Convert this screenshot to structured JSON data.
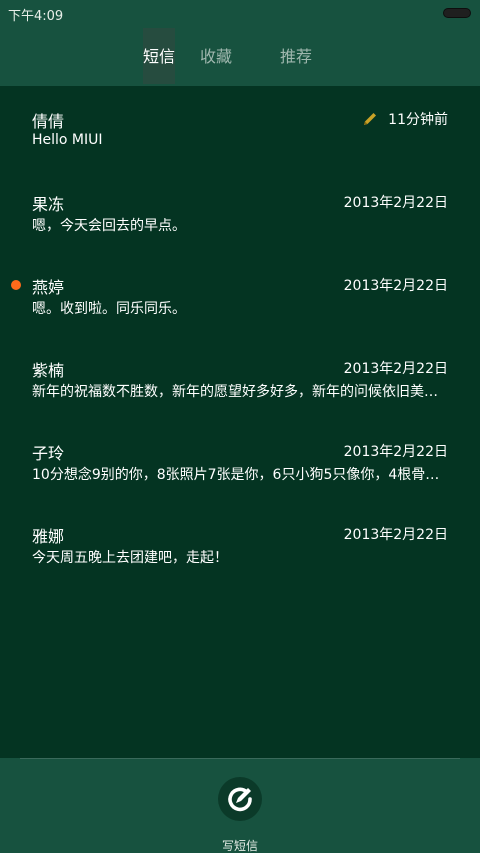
{
  "status_bar": {
    "time": "下午4:09"
  },
  "tabs": [
    {
      "label": "短信",
      "active": true
    },
    {
      "label": "收藏",
      "active": false
    },
    {
      "label": "推荐",
      "active": false
    }
  ],
  "conversations": [
    {
      "name": "倩倩",
      "date": "11分钟前",
      "preview": "Hello MIUI",
      "draft": true,
      "unread": false
    },
    {
      "name": "果冻",
      "date": "2013年2月22日",
      "preview": "嗯，今天会回去的早点。",
      "draft": false,
      "unread": false
    },
    {
      "name": "燕婷",
      "date": "2013年2月22日",
      "preview": "嗯。收到啦。同乐同乐。",
      "draft": false,
      "unread": true
    },
    {
      "name": "紫楠",
      "date": "2013年2月22日",
      "preview": "新年的祝福数不胜数，新年的愿望好多好多，新年的问候依旧美好…",
      "draft": false,
      "unread": false
    },
    {
      "name": "子玲",
      "date": "2013年2月22日",
      "preview": "10分想念9别的你，8张照片7张是你，6只小狗5只像你，4根骨头…",
      "draft": false,
      "unread": false
    },
    {
      "name": "雅娜",
      "date": "2013年2月22日",
      "preview": "今天周五晚上去团建吧，走起！",
      "draft": false,
      "unread": false
    }
  ],
  "compose": {
    "label": "写短信"
  },
  "colors": {
    "background": "#043422",
    "header": "#17523f",
    "unread_dot": "#ff6a1a",
    "draft_pencil": "#c9a227"
  }
}
